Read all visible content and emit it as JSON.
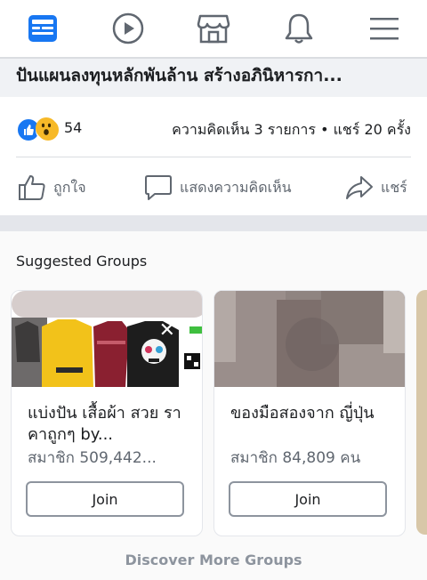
{
  "navbar": {
    "items": [
      {
        "icon": "news-feed-icon"
      },
      {
        "icon": "watch-video-icon"
      },
      {
        "icon": "marketplace-icon"
      },
      {
        "icon": "notifications-bell-icon"
      },
      {
        "icon": "menu-hamburger-icon"
      }
    ]
  },
  "post": {
    "title": "ปันแผนลงทุนหลักพันล้าน สร้างอภินิหารกา...",
    "reaction_count": "54",
    "comments_shares": "ความคิดเห็น 3 รายการ • แชร์ 20 ครั้ง",
    "actions": {
      "like": "ถูกใจ",
      "comment": "แสดงความคิดเห็น",
      "share": "แชร์"
    }
  },
  "suggested": {
    "title": "Suggested Groups",
    "groups": [
      {
        "name": "แบ่งปัน เสื้อผ้า สวย ราคาถูกๆ by...",
        "members": "สมาชิก 509,442...",
        "join_label": "Join"
      },
      {
        "name": "ของมือสองจาก ญี่ปุ่น",
        "members": "สมาชิก 84,809 คน",
        "join_label": "Join"
      }
    ],
    "discover_label": "Discover More Groups"
  },
  "colors": {
    "brand_blue": "#1877f2",
    "icon_gray": "#606770",
    "wow_yellow": "#f7b928"
  }
}
